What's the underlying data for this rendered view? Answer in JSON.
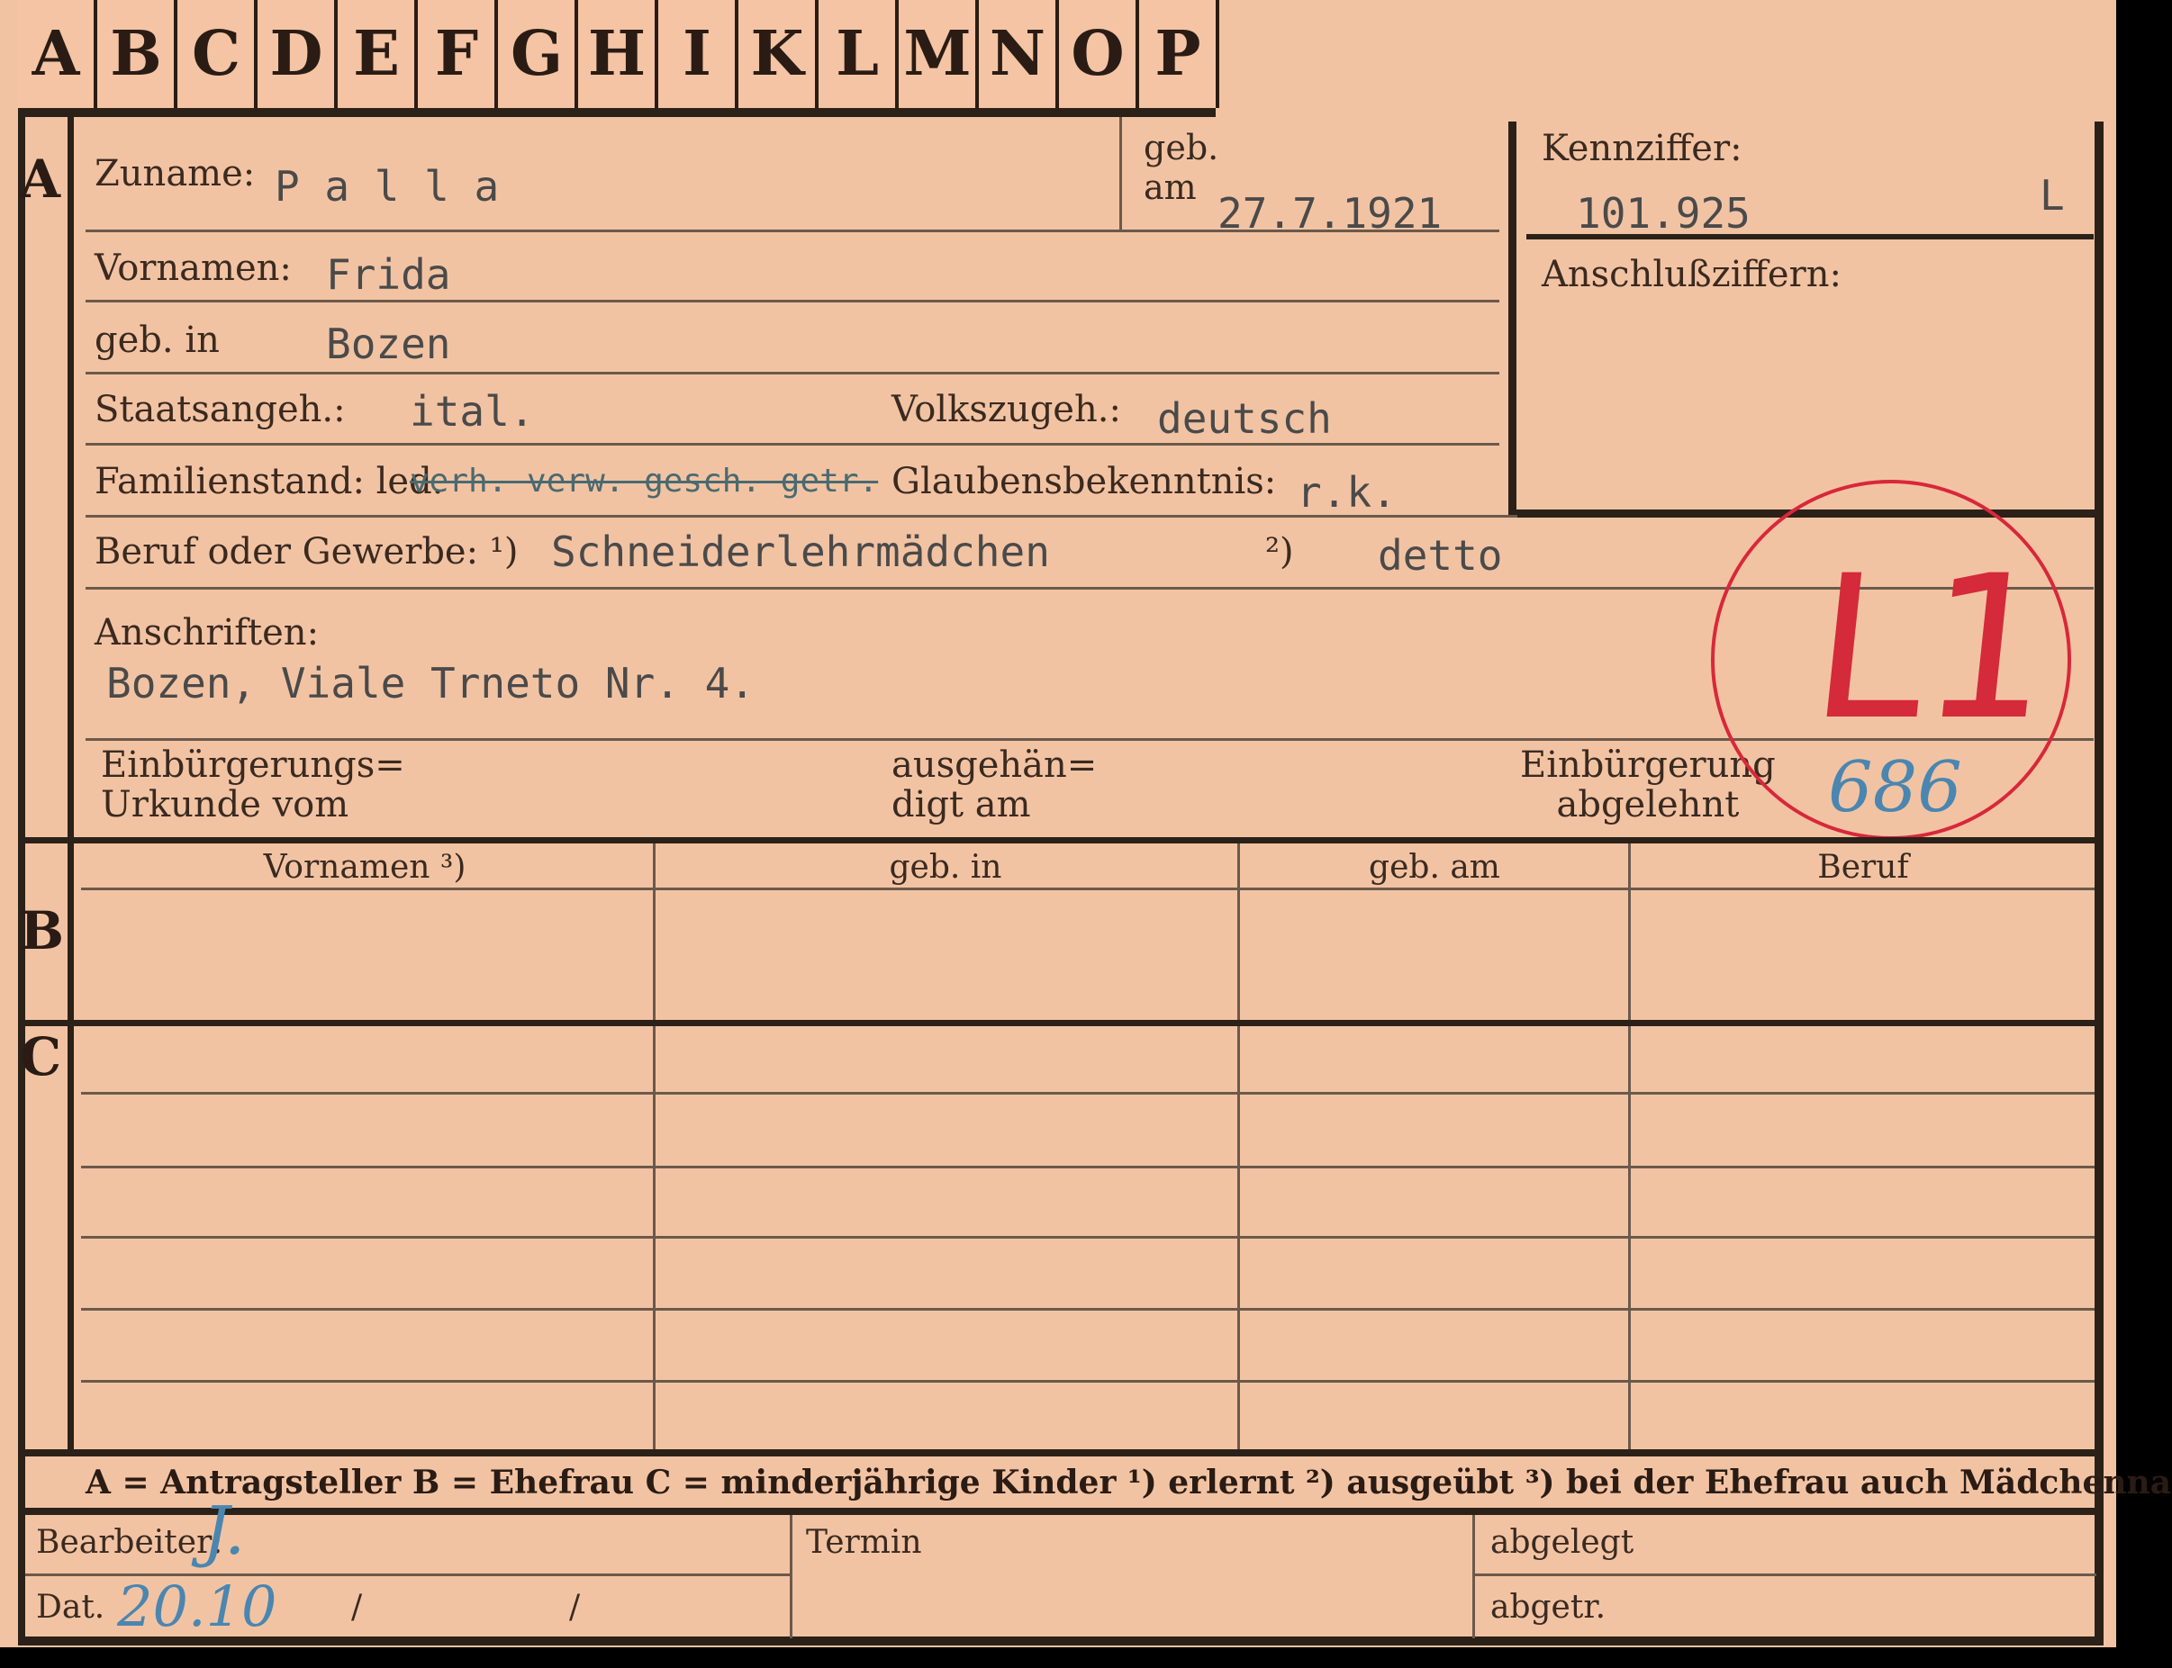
{
  "tabs": [
    "A",
    "B",
    "C",
    "D",
    "E",
    "F",
    "G",
    "H",
    "I",
    "K",
    "L",
    "M",
    "N",
    "O",
    "P"
  ],
  "section_markers": {
    "a": "A",
    "b": "B",
    "c": "C"
  },
  "labels": {
    "zuname": "Zuname:",
    "geb_am": "geb.\nam",
    "kennziffer": "Kennziffer:",
    "anschlussziffern": "Anschlußziffern:",
    "vornamen": "Vornamen:",
    "geb_in": "geb. in",
    "staatsangeh": "Staatsangeh.:",
    "volkszugeh": "Volkszugeh.:",
    "familienstand": "Familienstand: led.",
    "glaubensbekenntnis": "Glaubensbekenntnis:",
    "beruf": "Beruf oder Gewerbe: ¹)",
    "beruf_2": "²)",
    "anschriften": "Anschriften:",
    "einbuergerungs_urkunde": "Einbürgerungs=\nUrkunde vom",
    "ausgehaendigt": "ausgehän=\ndigt am",
    "einbuergerung_abgelehnt": "Einbürgerung\nabgelehnt",
    "bearbeiter": "Bearbeiter:",
    "termin": "Termin",
    "abgelegt": "abgelegt",
    "dat": "Dat.",
    "abgetr": "abgetr.",
    "date_sep": "/"
  },
  "values": {
    "zuname": "P a l l a",
    "geb_am": "27.7.1921",
    "kennziffer": "101.925",
    "kennziffer_suffix": "L",
    "vornamen": "Frida",
    "geb_in": "Bozen",
    "staatsangeh": "ital.",
    "volkszugeh": "deutsch",
    "familienstand_struck": "verh. verw. gesch. getr.",
    "glaubensbekenntnis": "r.k.",
    "beruf_1": "Schneiderlehrmädchen",
    "beruf_2": "detto",
    "anschrift": "Bozen, Viale Trneto Nr. 4.",
    "stamp": "L1",
    "stamp_number": "686",
    "bearbeiter_sign": "J.",
    "dat_hand": "20.10"
  },
  "table_headers": [
    "Vornamen ³)",
    "geb. in",
    "geb. am",
    "Beruf"
  ],
  "legend": "A = Antragsteller   B = Ehefrau   C = minderjährige Kinder   ¹) erlernt   ²) ausgeübt   ³) bei der Ehefrau auch Mädchenname",
  "colors": {
    "card": "#f2c3a3",
    "stamp": "#d8283a",
    "ink_blue": "#4a86b0"
  }
}
